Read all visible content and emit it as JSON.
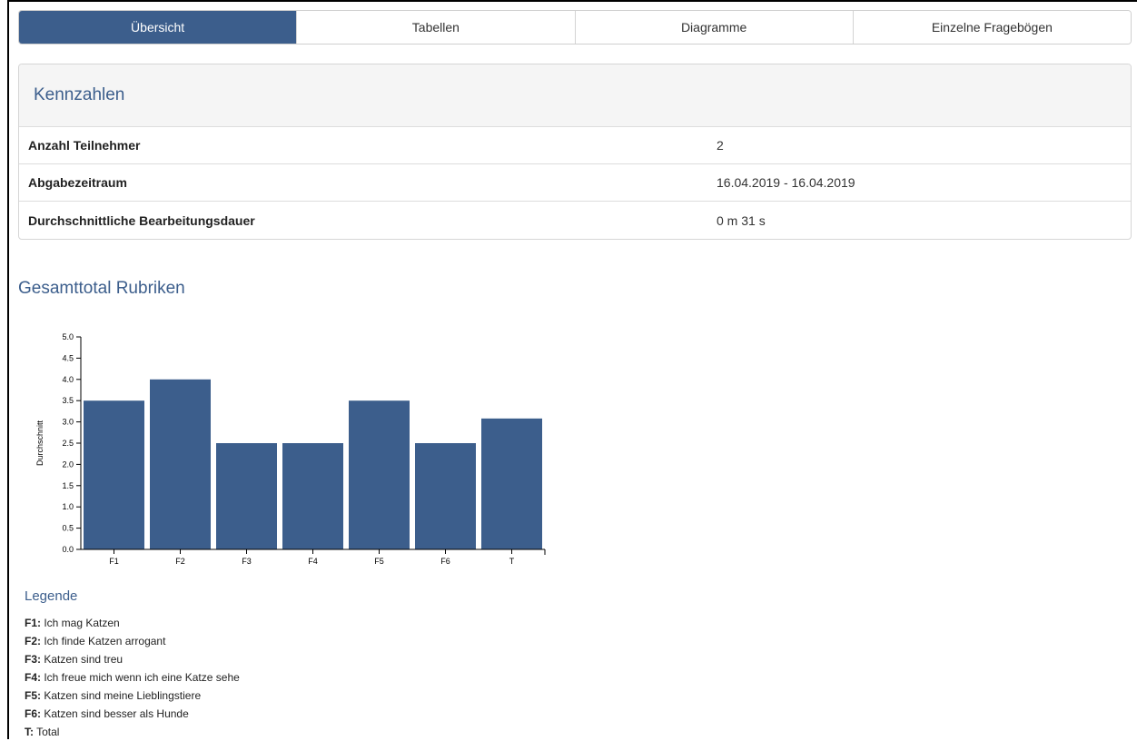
{
  "tabs": [
    "Übersicht",
    "Tabellen",
    "Diagramme",
    "Einzelne Fragebögen"
  ],
  "kennzahlen": {
    "title": "Kennzahlen",
    "rows": [
      {
        "label": "Anzahl Teilnehmer",
        "value": "2"
      },
      {
        "label": "Abgabezeitraum",
        "value": "16.04.2019 - 16.04.2019"
      },
      {
        "label": "Durchschnittliche Bearbeitungsdauer",
        "value": "0 m 31 s"
      }
    ]
  },
  "section_title": "Gesamttotal Rubriken",
  "chart_data": {
    "type": "bar",
    "categories": [
      "F1",
      "F2",
      "F3",
      "F4",
      "F5",
      "F6",
      "T"
    ],
    "values": [
      3.5,
      4.0,
      2.5,
      2.5,
      3.5,
      2.5,
      3.08
    ],
    "ylabel": "Durchschnitt",
    "xlabel": "",
    "ylim": [
      0,
      5
    ],
    "yticks": [
      "0.0",
      "0.5",
      "1.0",
      "1.5",
      "2.0",
      "2.5",
      "3.0",
      "3.5",
      "4.0",
      "4.5",
      "5.0"
    ],
    "bar_color": "#3c5e8c"
  },
  "legend": {
    "title": "Legende",
    "items": [
      {
        "key": "F1:",
        "text": "Ich mag Katzen"
      },
      {
        "key": "F2:",
        "text": "Ich finde Katzen arrogant"
      },
      {
        "key": "F3:",
        "text": "Katzen sind treu"
      },
      {
        "key": "F4:",
        "text": "Ich freue mich wenn ich eine Katze sehe"
      },
      {
        "key": "F5:",
        "text": "Katzen sind meine Lieblingstiere"
      },
      {
        "key": "F6:",
        "text": "Katzen sind besser als Hunde"
      },
      {
        "key": "T:",
        "text": "Total"
      }
    ]
  }
}
